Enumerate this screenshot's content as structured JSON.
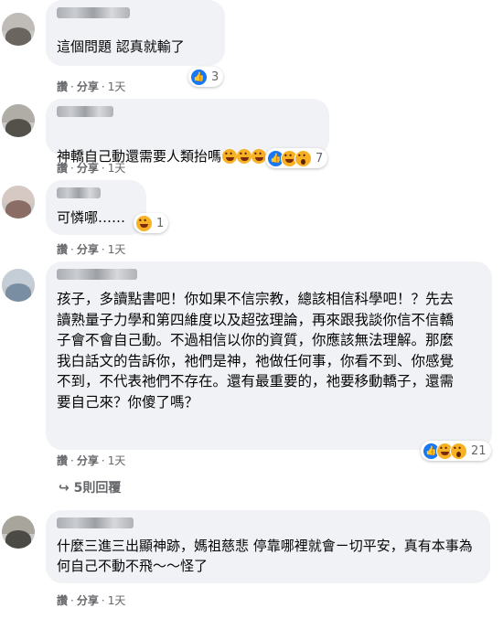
{
  "comments": [
    {
      "text": "這個問題 認真就輸了",
      "reaction_count": "3",
      "meta": {
        "like": "讚",
        "share": "分享",
        "time": "1天"
      }
    },
    {
      "text": "神轎自己動還需要人類抬嗎",
      "inline_emojis": [
        "haha-icon",
        "haha-icon",
        "haha-icon"
      ],
      "reaction_count": "7",
      "meta": {
        "like": "讚",
        "share": "分享",
        "time": "1天"
      }
    },
    {
      "text": "可憐哪……",
      "reaction_count": "1",
      "meta": {
        "like": "讚",
        "share": "分享",
        "time": "1天"
      }
    },
    {
      "text": "孩子，多讀點書吧！你如果不信宗教，總該相信科學吧！？先去讀熟量子力學和第四維度以及超弦理論，再來跟我談你信不信轎子會不會自己動。不過相信以你的資質，你應該無法理解。那麼我白話文的告訴你，祂們是神，祂做任何事，你看不到、你感覺不到，不代表祂們不存在。還有最重要的，祂要移動轎子，還需要自己來？你傻了嗎？",
      "reaction_count": "21",
      "meta": {
        "like": "讚",
        "share": "分享",
        "time": "1天"
      },
      "replies_label": "5則回覆"
    },
    {
      "text": "什麼三進三出顯神跡，媽祖慈悲 停靠哪裡就會ㄧ切平安，真有本事為何自己不動不飛～～怪了",
      "meta": {
        "like": "讚",
        "share": "分享",
        "time": "1天"
      }
    }
  ],
  "colors": {
    "bubble": "#f0f2f5",
    "meta": "#65676b",
    "like_blue": "#1877f2",
    "haha_yellow": "#f7b125"
  }
}
